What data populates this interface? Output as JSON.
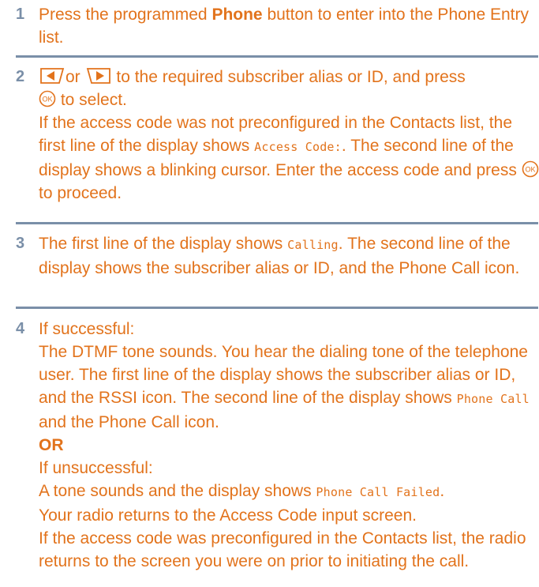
{
  "steps": [
    {
      "number": "1",
      "text": {
        "a": "Press the programmed ",
        "bold": "Phone",
        "b": " button to enter into the Phone Entry list."
      }
    },
    {
      "number": "2",
      "text": {
        "or": "or",
        "a": " to the required subscriber alias or ID, and press",
        "b": " to select.",
        "c": "If the access code was not preconfigured in the Contacts list, the first line of the display shows ",
        "mono1": "Access Code:",
        "d": ". The second line of the display shows a blinking cursor. Enter the access code and press ",
        "e": " to proceed."
      },
      "icons": [
        "left-arrow-key-icon",
        "right-arrow-key-icon",
        "ok-button-icon"
      ]
    },
    {
      "number": "3",
      "text": {
        "a": "The first line of the display shows ",
        "mono1": "Calling",
        "b": ". The second line of the display shows the subscriber alias or ID, and the Phone Call icon."
      }
    },
    {
      "number": "4",
      "text": {
        "a": "If successful:",
        "b": "The DTMF tone sounds. You hear the dialing tone of the telephone user. The first line of the display shows the subscriber alias or ID, and the RSSI icon. The second line of the display shows ",
        "mono1": "Phone Call",
        "c": " and the Phone Call icon.",
        "or": "OR",
        "d": "If unsuccessful:",
        "e": "A tone sounds and the display shows ",
        "mono2": "Phone Call Failed",
        "f": ".",
        "g": "Your radio returns to the Access Code input screen.",
        "h": "If the access code was preconfigured in the Contacts list, the radio returns to the screen you were on prior to initiating the call."
      }
    }
  ],
  "colors": {
    "text": "#e2731c",
    "number": "#7a8fa8",
    "rule": "#7a8fa8"
  }
}
